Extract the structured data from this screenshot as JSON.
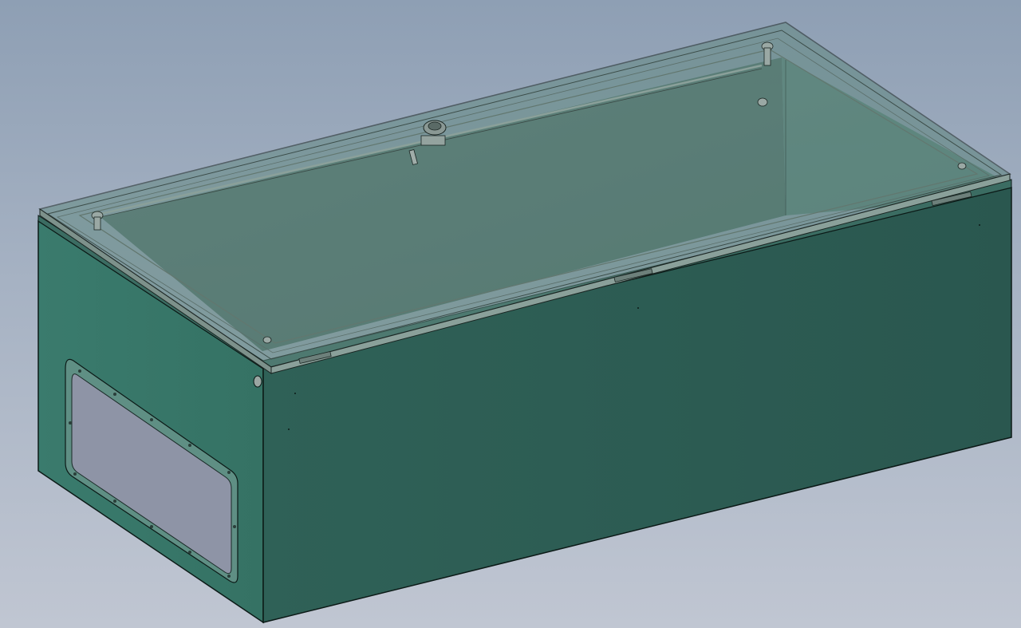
{
  "viewport": {
    "background_top": "#8e9fb4",
    "background_bottom": "#c0c6d2"
  },
  "model": {
    "body_color": "#2e5e55",
    "side_color": "#39796c",
    "lid_color": "#7fa79f",
    "edge_color": "#0c1a17",
    "window_color": "#8e94a6"
  }
}
